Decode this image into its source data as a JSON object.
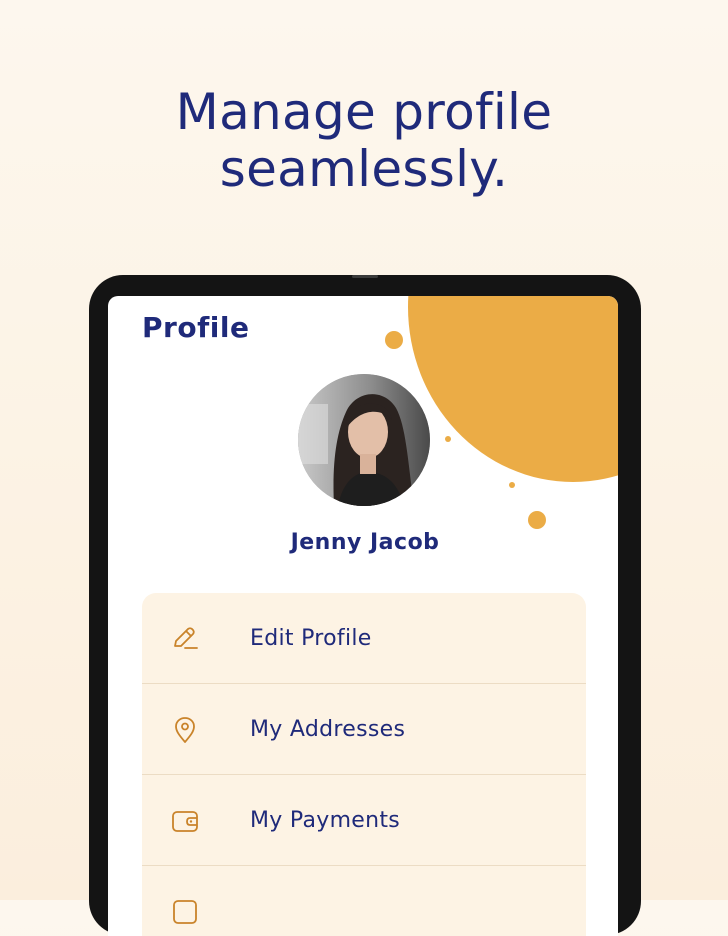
{
  "headline": {
    "line1": "Manage profile",
    "line2": "seamlessly."
  },
  "screen": {
    "title": "Profile",
    "user_name": "Jenny Jacob",
    "accent_color": "#ebac46",
    "text_color": "#1f2a7a"
  },
  "menu": {
    "items": [
      {
        "label": "Edit Profile",
        "icon": "edit-icon"
      },
      {
        "label": "My Addresses",
        "icon": "location-pin-icon"
      },
      {
        "label": "My Payments",
        "icon": "wallet-icon"
      },
      {
        "label": "",
        "icon": "list-icon"
      }
    ]
  }
}
